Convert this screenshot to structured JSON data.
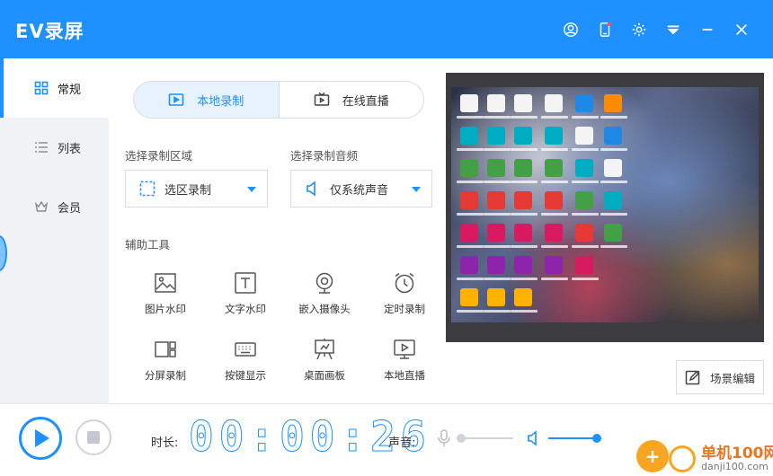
{
  "app": {
    "title": "EV录屏"
  },
  "titlebar": {
    "icons": [
      "user-icon",
      "phone-icon",
      "gear-icon",
      "collapse-icon",
      "minimize-icon",
      "close-icon"
    ]
  },
  "sidebar": {
    "items": [
      {
        "label": "常规",
        "icon": "grid-icon",
        "active": true
      },
      {
        "label": "列表",
        "icon": "list-icon",
        "active": false
      },
      {
        "label": "会员",
        "icon": "crown-icon",
        "active": false
      }
    ]
  },
  "mode_tabs": [
    {
      "label": "本地录制",
      "icon": "record-local-icon",
      "active": true
    },
    {
      "label": "在线直播",
      "icon": "tv-icon",
      "active": false
    }
  ],
  "area": {
    "label": "选择录制区域",
    "value": "选区录制"
  },
  "audio": {
    "label": "选择录制音频",
    "value": "仅系统声音"
  },
  "tools": {
    "label": "辅助工具",
    "items": [
      {
        "label": "图片水印",
        "icon": "image-icon"
      },
      {
        "label": "文字水印",
        "icon": "text-icon"
      },
      {
        "label": "嵌入摄像头",
        "icon": "webcam-icon"
      },
      {
        "label": "定时录制",
        "icon": "alarm-clock-icon"
      },
      {
        "label": "分屏录制",
        "icon": "split-screen-icon"
      },
      {
        "label": "按键显示",
        "icon": "keyboard-icon"
      },
      {
        "label": "桌面画板",
        "icon": "easel-icon"
      },
      {
        "label": "本地直播",
        "icon": "screen-play-icon"
      }
    ]
  },
  "scene_edit": {
    "label": "场景编辑"
  },
  "bottom": {
    "time_label": "时长:",
    "timer": "00:00:26",
    "sound_label": "声音:",
    "mic_level": 0.0,
    "speaker_level": 1.0
  },
  "watermark": {
    "title": "单机100网",
    "url": "danji100.com"
  },
  "colors": {
    "accent": "#1e90ff",
    "sidebar_bg": "#f0f2f5",
    "watermark": "#f6a623"
  }
}
